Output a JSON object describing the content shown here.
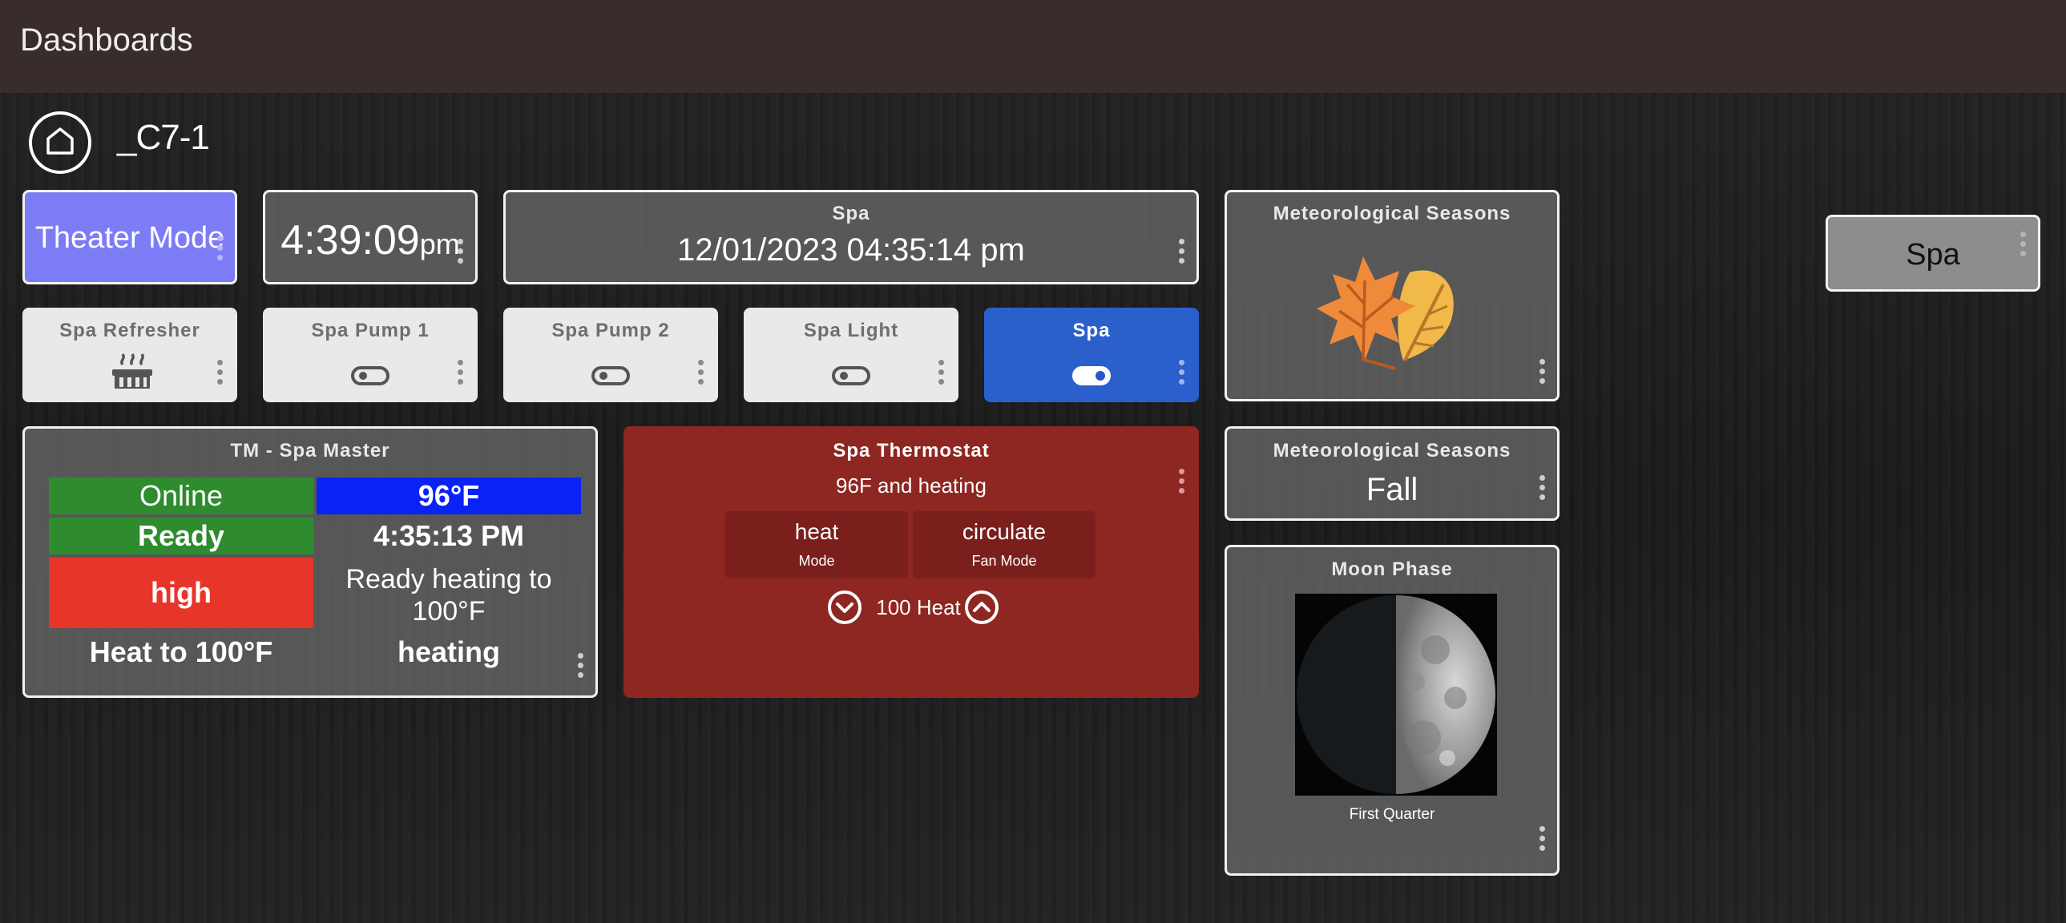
{
  "topbar": {
    "title": "Dashboards"
  },
  "hub": {
    "name": "_C7-1"
  },
  "tiles": {
    "theater_mode": {
      "label": "Theater Mode",
      "bg": "#7d7cf7"
    },
    "clock": {
      "time": "4:39:09",
      "ampm": "pm"
    },
    "spa_date": {
      "title": "Spa",
      "value": "12/01/2023 04:35:14 pm"
    },
    "seasons_icon": {
      "title": "Meteorological Seasons",
      "icon": "autumn-leaves-icon"
    },
    "spa_side": {
      "label": "Spa"
    },
    "spa_refresher": {
      "title": "Spa Refresher",
      "icon": "hot-tub-icon"
    },
    "spa_pump1": {
      "title": "Spa Pump 1",
      "state": "off"
    },
    "spa_pump2": {
      "title": "Spa Pump 2",
      "state": "off"
    },
    "spa_light": {
      "title": "Spa Light",
      "state": "off"
    },
    "spa_switch": {
      "title": "Spa",
      "state": "on",
      "bg": "#2b5fcb"
    },
    "spa_master": {
      "title": "TM - Spa Master",
      "left": [
        "Online",
        "Ready",
        "high",
        "Heat to 100°F"
      ],
      "right": [
        "96°F",
        "4:35:13 PM",
        "Ready heating to 100°F",
        "heating"
      ],
      "colors": {
        "green": "#2e8b2e",
        "blue": "#0a22f5",
        "red": "#e8352a"
      }
    },
    "thermostat": {
      "title": "Spa Thermostat",
      "status": "96F and heating",
      "mode": {
        "value": "heat",
        "label": "Mode"
      },
      "fan": {
        "value": "circulate",
        "label": "Fan Mode"
      },
      "setpoint": "100 Heat",
      "bg": "#8e2621"
    },
    "seasons_text": {
      "title": "Meteorological Seasons",
      "value": "Fall"
    },
    "moon": {
      "title": "Moon Phase",
      "caption": "First Quarter",
      "icon": "moon-first-quarter-icon"
    }
  }
}
